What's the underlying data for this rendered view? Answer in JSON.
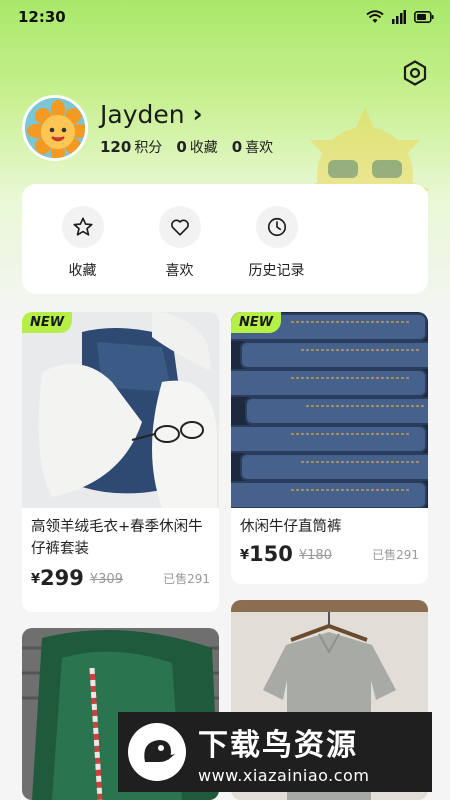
{
  "status_bar": {
    "time": "12:30",
    "icons": [
      "wifi-icon",
      "signal-icon",
      "battery-icon"
    ]
  },
  "header": {
    "settings_icon": "settings-hexagon-icon"
  },
  "profile": {
    "name": "Jayden",
    "chevron": "›",
    "stats": [
      {
        "value": "120",
        "label": "积分"
      },
      {
        "value": "0",
        "label": "收藏"
      },
      {
        "value": "0",
        "label": "喜欢"
      }
    ]
  },
  "quick_actions": [
    {
      "label": "收藏",
      "icon": "star-icon"
    },
    {
      "label": "喜欢",
      "icon": "heart-icon"
    },
    {
      "label": "历史记录",
      "icon": "clock-icon"
    }
  ],
  "products": [
    {
      "badge": "NEW",
      "title": "高领羊绒毛衣+春季休闲牛仔裤套装",
      "currency": "¥",
      "price": "299",
      "old_price": "¥309",
      "sold": "已售291",
      "image": "sweater-and-jeans-photo"
    },
    {
      "badge": "NEW",
      "title": "休闲牛仔直筒裤",
      "currency": "¥",
      "price": "150",
      "old_price": "¥180",
      "sold": "已售291",
      "image": "stacked-jeans-photo"
    },
    {
      "image": "green-fur-coat-photo"
    },
    {
      "image": "linen-shirt-on-hanger-photo"
    }
  ],
  "watermark": {
    "title": "下载鸟资源",
    "url": "www.xiazainiao.com"
  },
  "colors": {
    "accent_green": "#b6f047",
    "header_green": "#a9e86a"
  }
}
